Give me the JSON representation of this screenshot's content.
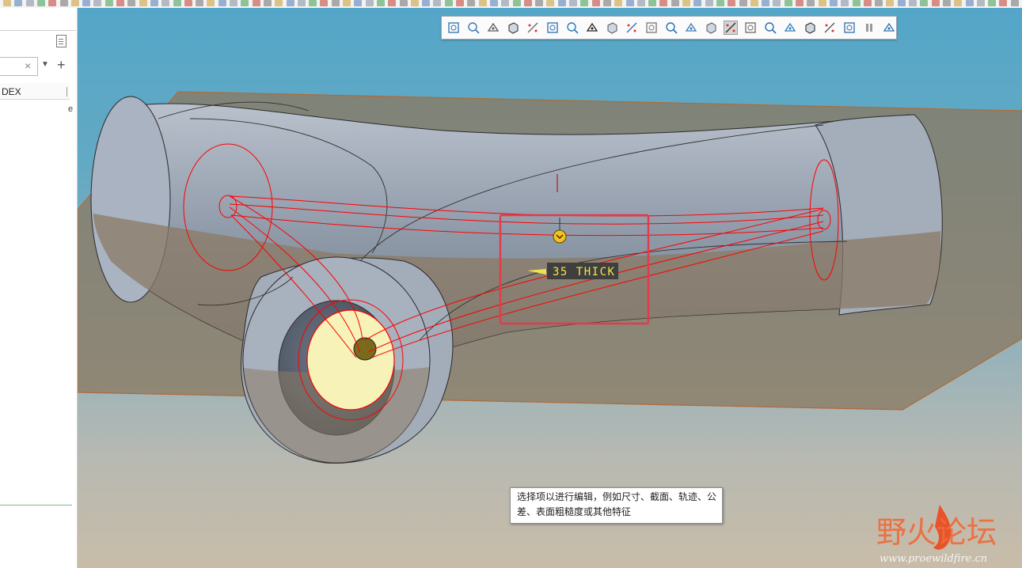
{
  "left_panel": {
    "filter": {
      "value": "",
      "clear_symbol": "×"
    },
    "dropdown_symbol": "▼",
    "add_symbol": "+",
    "column_header": "DEX",
    "column_header_right": "e"
  },
  "view_toolbar": {
    "buttons": [
      {
        "icon": "refit-icon"
      },
      {
        "icon": "zoom-in-icon"
      },
      {
        "icon": "zoom-out-icon"
      },
      {
        "icon": "repaint-icon"
      },
      {
        "icon": "spin-center-icon"
      },
      {
        "icon": "saved-orientations-icon"
      },
      {
        "icon": "display-style-icon"
      },
      {
        "icon": "view-manager-icon"
      },
      {
        "icon": "datum-planes-icon"
      },
      {
        "icon": "datum-axes-icon"
      },
      {
        "icon": "wireframe-icon"
      },
      {
        "icon": "plane-display-icon"
      },
      {
        "icon": "point-display-icon"
      },
      {
        "icon": "csys-display-icon"
      },
      {
        "icon": "annotation-display-icon",
        "active": true
      },
      {
        "icon": "axis-tag-icon"
      },
      {
        "icon": "point-tag-icon"
      },
      {
        "icon": "csys-tag-icon"
      },
      {
        "icon": "spin-center-display-icon"
      },
      {
        "icon": "connector-icon"
      },
      {
        "icon": "3d-annotation-icon"
      },
      {
        "icon": "pause-icon"
      },
      {
        "icon": "annotation-orientation-icon"
      }
    ]
  },
  "model": {
    "annotation_label": "35 THICK",
    "colors": {
      "highlight": "#ff0000",
      "selection_box": "#e23b4a",
      "annotation_bg": "#3f3f3f",
      "annotation_text": "#f2e34a"
    }
  },
  "tooltip": {
    "line1": "选择项以进行编辑，例如尺寸、截面、轨迹、公",
    "line2": "差、表面粗糙度或其他特征"
  },
  "watermark": {
    "brand": "野火论坛",
    "url": "www.proewildfire.cn"
  }
}
